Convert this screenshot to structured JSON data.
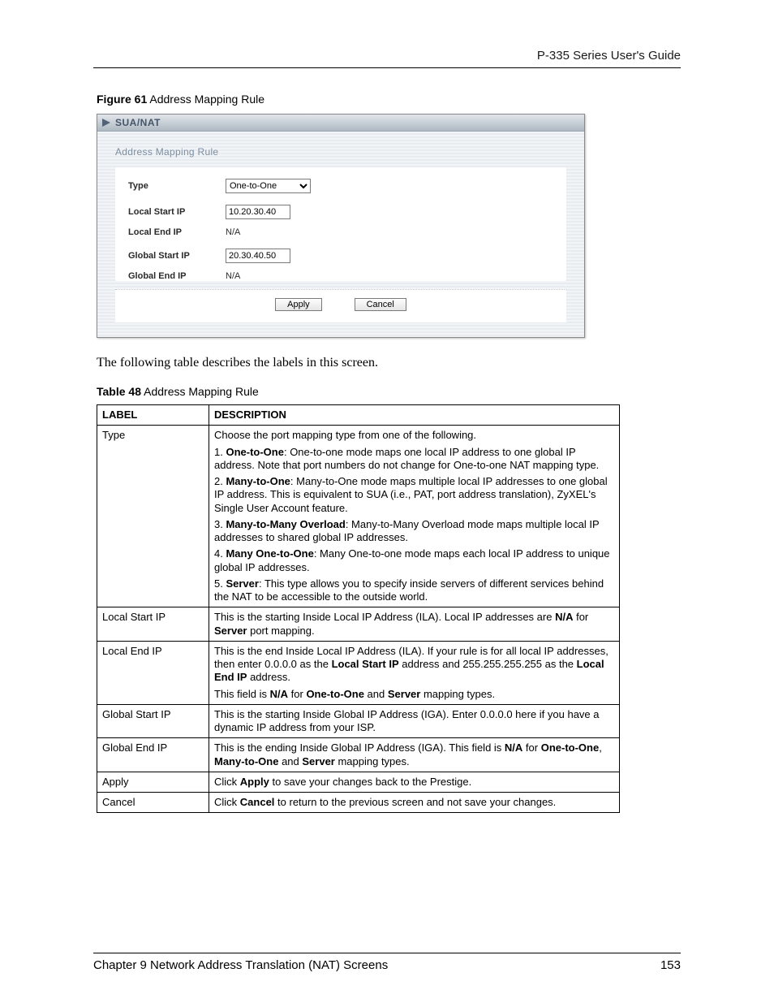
{
  "header": {
    "guide_title": "P-335 Series User's Guide"
  },
  "figure": {
    "label_bold": "Figure 61",
    "label_rest": "   Address Mapping Rule",
    "titlebar": "SUA/NAT",
    "section_title": "Address Mapping Rule",
    "form": {
      "type_label": "Type",
      "type_value": "One-to-One",
      "local_start_label": "Local Start IP",
      "local_start_value": "10.20.30.40",
      "local_end_label": "Local End IP",
      "local_end_value": "N/A",
      "global_start_label": "Global Start IP",
      "global_start_value": "20.30.40.50",
      "global_end_label": "Global End IP",
      "global_end_value": "N/A",
      "apply": "Apply",
      "cancel": "Cancel"
    }
  },
  "paragraph": "The following table describes the labels in this screen.",
  "table": {
    "caption_bold": "Table 48",
    "caption_rest": "   Address Mapping Rule",
    "head_label": "LABEL",
    "head_desc": "DESCRIPTION",
    "rows": {
      "type": {
        "label": "Type",
        "p0": "Choose the port mapping type from one of the following.",
        "p1a": "1. ",
        "p1b": "One-to-One",
        "p1c": ": One-to-one mode maps one local IP address to one global IP address. Note that port numbers do not change for One-to-one NAT mapping type.",
        "p2a": "2. ",
        "p2b": "Many-to-One",
        "p2c": ": Many-to-One mode maps multiple local IP addresses to one global IP address. This is equivalent to SUA (i.e., PAT, port address translation), ZyXEL's Single User Account feature.",
        "p3a": "3. ",
        "p3b": "Many-to-Many Overload",
        "p3c": ": Many-to-Many Overload mode maps multiple local IP addresses to shared global IP addresses.",
        "p4a": "4. ",
        "p4b": "Many One-to-One",
        "p4c": ": Many One-to-one mode maps each local IP address to unique global IP addresses.",
        "p5a": "5. ",
        "p5b": "Server",
        "p5c": ": This type allows you to specify inside servers of different services behind the NAT to be accessible to the outside world."
      },
      "local_start": {
        "label": "Local Start IP",
        "t1": "This is the starting Inside Local IP Address (ILA). Local IP addresses are ",
        "t2": "N/A",
        "t3": " for ",
        "t4": "Server",
        "t5": " port mapping."
      },
      "local_end": {
        "label": "Local End IP",
        "p1a": "This is the end Inside Local IP Address (ILA). If your rule is for all local IP addresses, then enter 0.0.0.0 as the ",
        "p1b": "Local Start IP",
        "p1c": " address and 255.255.255.255 as the ",
        "p1d": "Local End IP",
        "p1e": " address.",
        "p2a": "This field is ",
        "p2b": "N/A",
        "p2c": " for ",
        "p2d": "One-to-One",
        "p2e": " and ",
        "p2f": "Server",
        "p2g": " mapping types."
      },
      "global_start": {
        "label": "Global Start IP",
        "t": "This is the starting Inside Global IP Address (IGA). Enter 0.0.0.0 here if you have a dynamic IP address from your ISP."
      },
      "global_end": {
        "label": "Global End IP",
        "t1": "This is the ending Inside Global IP Address (IGA). This field is ",
        "t2": "N/A",
        "t3": " for ",
        "t4": "One-to-One",
        "t5": ", ",
        "t6": "Many-to-One",
        "t7": " and ",
        "t8": "Server",
        "t9": " mapping types."
      },
      "apply": {
        "label": "Apply",
        "t1": "Click ",
        "t2": "Apply",
        "t3": " to save your changes back to the Prestige."
      },
      "cancel": {
        "label": "Cancel",
        "t1": "Click ",
        "t2": "Cancel",
        "t3": " to return to the previous screen and not save your changes."
      }
    }
  },
  "footer": {
    "chapter": "Chapter 9 Network Address Translation (NAT) Screens",
    "page": "153"
  }
}
